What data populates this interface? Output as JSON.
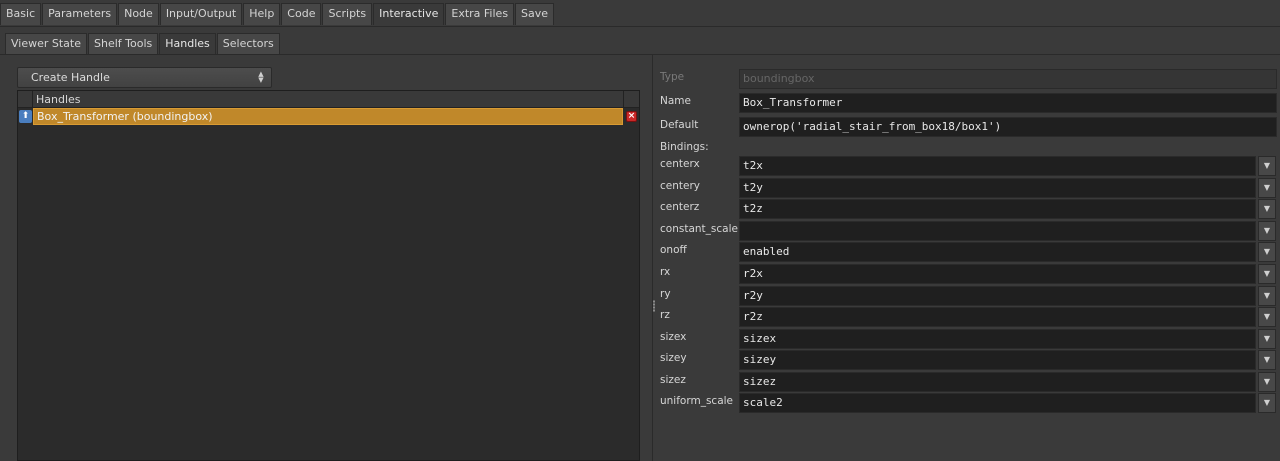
{
  "main_tabs": [
    "Basic",
    "Parameters",
    "Node",
    "Input/Output",
    "Help",
    "Code",
    "Scripts",
    "Interactive",
    "Extra Files",
    "Save"
  ],
  "active_main_tab": "Interactive",
  "sub_tabs": [
    "Viewer State",
    "Shelf Tools",
    "Handles",
    "Selectors"
  ],
  "active_sub_tab": "Handles",
  "create_handle": {
    "label": "Create Handle"
  },
  "handles": {
    "header": "Handles",
    "items": [
      {
        "label": "Box_Transformer (boundingbox)",
        "selected": true
      }
    ]
  },
  "properties": {
    "type": {
      "label": "Type",
      "value": "boundingbox"
    },
    "name": {
      "label": "Name",
      "value": "Box_Transformer"
    },
    "default": {
      "label": "Default",
      "value": "ownerop('radial_stair_from_box18/box1')"
    },
    "bindings_label": "Bindings:",
    "bindings": [
      {
        "label": "centerx",
        "value": "t2x"
      },
      {
        "label": "centery",
        "value": "t2y"
      },
      {
        "label": "centerz",
        "value": "t2z"
      },
      {
        "label": "constant_scale",
        "value": ""
      },
      {
        "label": "onoff",
        "value": "enabled"
      },
      {
        "label": "rx",
        "value": "r2x"
      },
      {
        "label": "ry",
        "value": "r2y"
      },
      {
        "label": "rz",
        "value": "r2z"
      },
      {
        "label": "sizex",
        "value": "sizex"
      },
      {
        "label": "sizey",
        "value": "sizey"
      },
      {
        "label": "sizez",
        "value": "sizez"
      },
      {
        "label": "uniform_scale",
        "value": "scale2"
      }
    ]
  },
  "colors": {
    "selection": "#c0882a",
    "field_bg": "#1f1f1f",
    "panel_bg": "#3a3a3a"
  },
  "icons": {
    "handle_row": "handle-arrow-icon",
    "delete": "delete-x-icon",
    "dropdown": "dropdown-arrow-icon",
    "spinner": "updown-arrows-icon"
  }
}
